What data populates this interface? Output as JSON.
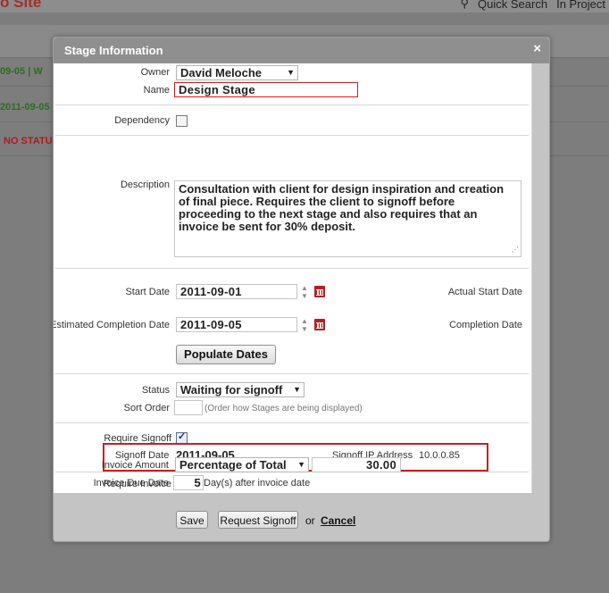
{
  "background": {
    "brand": "o Site",
    "quick_search": "Quick Search",
    "in_projects": "In Project",
    "rows": [
      {
        "text": "09-05 | W",
        "color": "#2d6e1e"
      },
      {
        "text": "2011-09-05",
        "color": "#2d6e1e"
      },
      {
        "text": "NO STATU",
        "color": "#b11a1a"
      }
    ]
  },
  "dialog": {
    "title": "Stage Information",
    "close": "×",
    "owner": {
      "label": "Owner",
      "value": "David Meloche"
    },
    "name": {
      "label": "Name",
      "value": "Design Stage"
    },
    "dependency": {
      "label": "Dependency",
      "checked": false
    },
    "description": {
      "label": "Description",
      "value": "Consultation with client for design inspiration and creation of final piece.  Requires the client to signoff before proceeding to the next stage and also requires that an invoice be sent for 30% deposit."
    },
    "start_date": {
      "label": "Start Date",
      "value": "2011-09-01",
      "actual_label": "Actual Start Date"
    },
    "est_completion": {
      "label": "Estimated Completion Date",
      "value": "2011-09-05",
      "completion_label": "Completion Date"
    },
    "populate_button": "Populate Dates",
    "status": {
      "label": "Status",
      "value": "Waiting for signoff"
    },
    "sort_order": {
      "label": "Sort Order",
      "value": "",
      "hint": "(Order how Stages are being displayed)"
    },
    "require_signoff": {
      "label": "Require Signoff",
      "checked": true
    },
    "signoff_date": {
      "label": "Signoff Date",
      "value": "2011-09-05"
    },
    "signoff_ip": {
      "label": "Signoff IP Address",
      "value": "10.0.0.85"
    },
    "require_invoice": {
      "label": "Require Invoice",
      "checked": true
    },
    "invoice_amount": {
      "label": "Invoice Amount",
      "type": "Percentage of Total",
      "value": "30.00"
    },
    "invoice_due": {
      "label": "Invoice Due Date",
      "value": "5",
      "suffix": "Day(s) after invoice date"
    },
    "buttons": {
      "save": "Save",
      "request_signoff": "Request Signoff",
      "or": "or",
      "cancel": "Cancel"
    }
  },
  "colors": {
    "highlight": "#d21b1b",
    "titlebar": "#8f8f8f"
  }
}
